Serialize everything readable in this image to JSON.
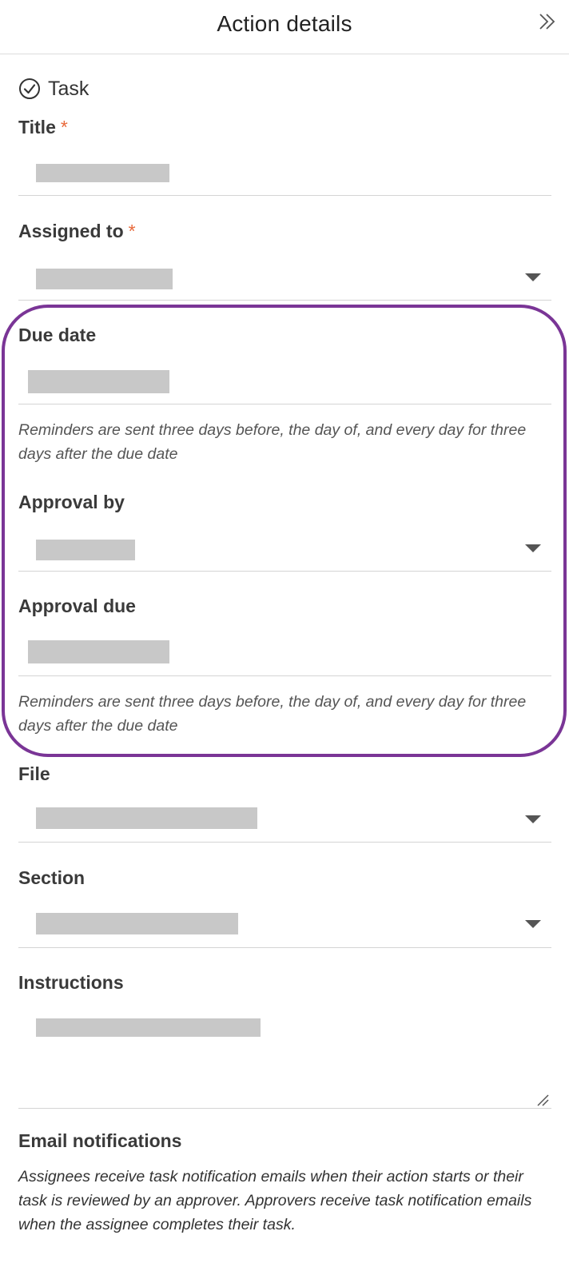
{
  "header": {
    "title": "Action details",
    "collapse_icon": "double-chevron-right-icon"
  },
  "task_type": {
    "icon": "check-circle-icon",
    "label": "Task"
  },
  "fields": {
    "title": {
      "label": "Title",
      "required_mark": "*"
    },
    "assigned_to": {
      "label": "Assigned to",
      "required_mark": "*"
    },
    "due_date": {
      "label": "Due date",
      "hint": "Reminders are sent three days before, the day of, and every day for three days after the due date"
    },
    "approval_by": {
      "label": "Approval by"
    },
    "approval_due": {
      "label": "Approval due",
      "hint": "Reminders are sent three days before, the day of, and every day for three days after the due date"
    },
    "file": {
      "label": "File"
    },
    "section": {
      "label": "Section"
    },
    "instructions": {
      "label": "Instructions"
    }
  },
  "email_notifications": {
    "title": "Email notifications",
    "description": "Assignees receive task notification emails when their action starts or their task is reviewed by an approver. Approvers receive task notification emails when the assignee completes their task."
  },
  "colors": {
    "required": "#e8693b",
    "highlight": "#7a3596",
    "redacted_value": "#c8c8c8"
  }
}
